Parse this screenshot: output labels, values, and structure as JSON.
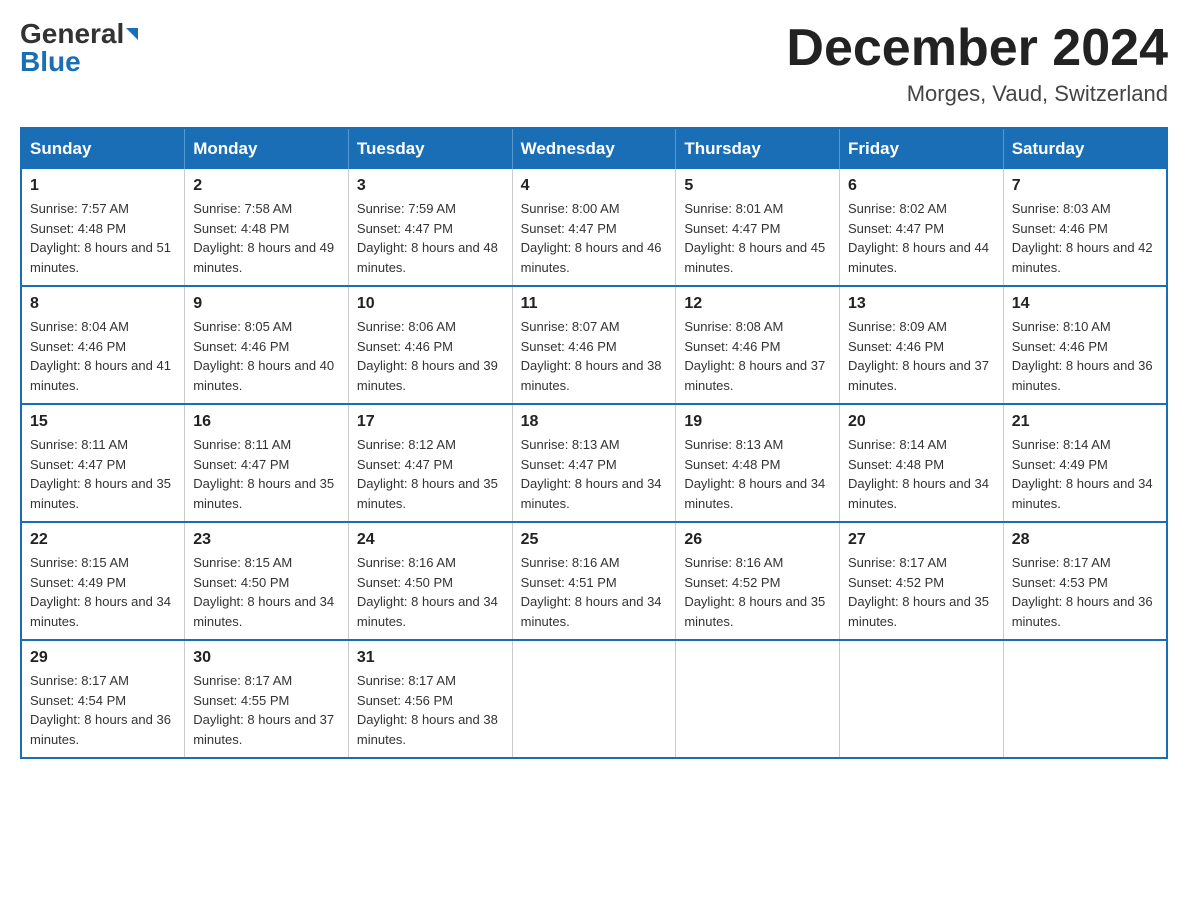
{
  "header": {
    "logo_general": "General",
    "logo_blue": "Blue",
    "month_title": "December 2024",
    "location": "Morges, Vaud, Switzerland"
  },
  "days_of_week": [
    "Sunday",
    "Monday",
    "Tuesday",
    "Wednesday",
    "Thursday",
    "Friday",
    "Saturday"
  ],
  "weeks": [
    [
      {
        "day": "1",
        "sunrise": "7:57 AM",
        "sunset": "4:48 PM",
        "daylight": "8 hours and 51 minutes."
      },
      {
        "day": "2",
        "sunrise": "7:58 AM",
        "sunset": "4:48 PM",
        "daylight": "8 hours and 49 minutes."
      },
      {
        "day": "3",
        "sunrise": "7:59 AM",
        "sunset": "4:47 PM",
        "daylight": "8 hours and 48 minutes."
      },
      {
        "day": "4",
        "sunrise": "8:00 AM",
        "sunset": "4:47 PM",
        "daylight": "8 hours and 46 minutes."
      },
      {
        "day": "5",
        "sunrise": "8:01 AM",
        "sunset": "4:47 PM",
        "daylight": "8 hours and 45 minutes."
      },
      {
        "day": "6",
        "sunrise": "8:02 AM",
        "sunset": "4:47 PM",
        "daylight": "8 hours and 44 minutes."
      },
      {
        "day": "7",
        "sunrise": "8:03 AM",
        "sunset": "4:46 PM",
        "daylight": "8 hours and 42 minutes."
      }
    ],
    [
      {
        "day": "8",
        "sunrise": "8:04 AM",
        "sunset": "4:46 PM",
        "daylight": "8 hours and 41 minutes."
      },
      {
        "day": "9",
        "sunrise": "8:05 AM",
        "sunset": "4:46 PM",
        "daylight": "8 hours and 40 minutes."
      },
      {
        "day": "10",
        "sunrise": "8:06 AM",
        "sunset": "4:46 PM",
        "daylight": "8 hours and 39 minutes."
      },
      {
        "day": "11",
        "sunrise": "8:07 AM",
        "sunset": "4:46 PM",
        "daylight": "8 hours and 38 minutes."
      },
      {
        "day": "12",
        "sunrise": "8:08 AM",
        "sunset": "4:46 PM",
        "daylight": "8 hours and 37 minutes."
      },
      {
        "day": "13",
        "sunrise": "8:09 AM",
        "sunset": "4:46 PM",
        "daylight": "8 hours and 37 minutes."
      },
      {
        "day": "14",
        "sunrise": "8:10 AM",
        "sunset": "4:46 PM",
        "daylight": "8 hours and 36 minutes."
      }
    ],
    [
      {
        "day": "15",
        "sunrise": "8:11 AM",
        "sunset": "4:47 PM",
        "daylight": "8 hours and 35 minutes."
      },
      {
        "day": "16",
        "sunrise": "8:11 AM",
        "sunset": "4:47 PM",
        "daylight": "8 hours and 35 minutes."
      },
      {
        "day": "17",
        "sunrise": "8:12 AM",
        "sunset": "4:47 PM",
        "daylight": "8 hours and 35 minutes."
      },
      {
        "day": "18",
        "sunrise": "8:13 AM",
        "sunset": "4:47 PM",
        "daylight": "8 hours and 34 minutes."
      },
      {
        "day": "19",
        "sunrise": "8:13 AM",
        "sunset": "4:48 PM",
        "daylight": "8 hours and 34 minutes."
      },
      {
        "day": "20",
        "sunrise": "8:14 AM",
        "sunset": "4:48 PM",
        "daylight": "8 hours and 34 minutes."
      },
      {
        "day": "21",
        "sunrise": "8:14 AM",
        "sunset": "4:49 PM",
        "daylight": "8 hours and 34 minutes."
      }
    ],
    [
      {
        "day": "22",
        "sunrise": "8:15 AM",
        "sunset": "4:49 PM",
        "daylight": "8 hours and 34 minutes."
      },
      {
        "day": "23",
        "sunrise": "8:15 AM",
        "sunset": "4:50 PM",
        "daylight": "8 hours and 34 minutes."
      },
      {
        "day": "24",
        "sunrise": "8:16 AM",
        "sunset": "4:50 PM",
        "daylight": "8 hours and 34 minutes."
      },
      {
        "day": "25",
        "sunrise": "8:16 AM",
        "sunset": "4:51 PM",
        "daylight": "8 hours and 34 minutes."
      },
      {
        "day": "26",
        "sunrise": "8:16 AM",
        "sunset": "4:52 PM",
        "daylight": "8 hours and 35 minutes."
      },
      {
        "day": "27",
        "sunrise": "8:17 AM",
        "sunset": "4:52 PM",
        "daylight": "8 hours and 35 minutes."
      },
      {
        "day": "28",
        "sunrise": "8:17 AM",
        "sunset": "4:53 PM",
        "daylight": "8 hours and 36 minutes."
      }
    ],
    [
      {
        "day": "29",
        "sunrise": "8:17 AM",
        "sunset": "4:54 PM",
        "daylight": "8 hours and 36 minutes."
      },
      {
        "day": "30",
        "sunrise": "8:17 AM",
        "sunset": "4:55 PM",
        "daylight": "8 hours and 37 minutes."
      },
      {
        "day": "31",
        "sunrise": "8:17 AM",
        "sunset": "4:56 PM",
        "daylight": "8 hours and 38 minutes."
      },
      null,
      null,
      null,
      null
    ]
  ]
}
